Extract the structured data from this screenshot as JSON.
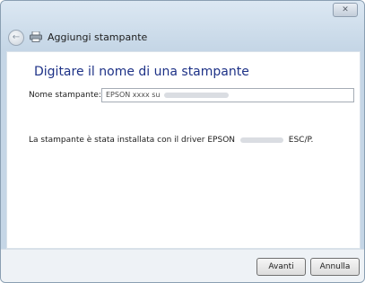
{
  "window": {
    "title": "Aggiungi stampante",
    "close_label": "✕"
  },
  "page": {
    "heading": "Digitare il nome di una stampante",
    "field_label": "Nome stampante:",
    "field_value_prefix": "EPSON xxxx su",
    "info_prefix": "La stampante è stata installata con il driver EPSON",
    "info_suffix": "ESC/P."
  },
  "buttons": {
    "next": "Avanti",
    "cancel": "Annulla"
  },
  "icons": {
    "back": "back-arrow-icon",
    "printer": "printer-icon",
    "close": "close-icon"
  }
}
